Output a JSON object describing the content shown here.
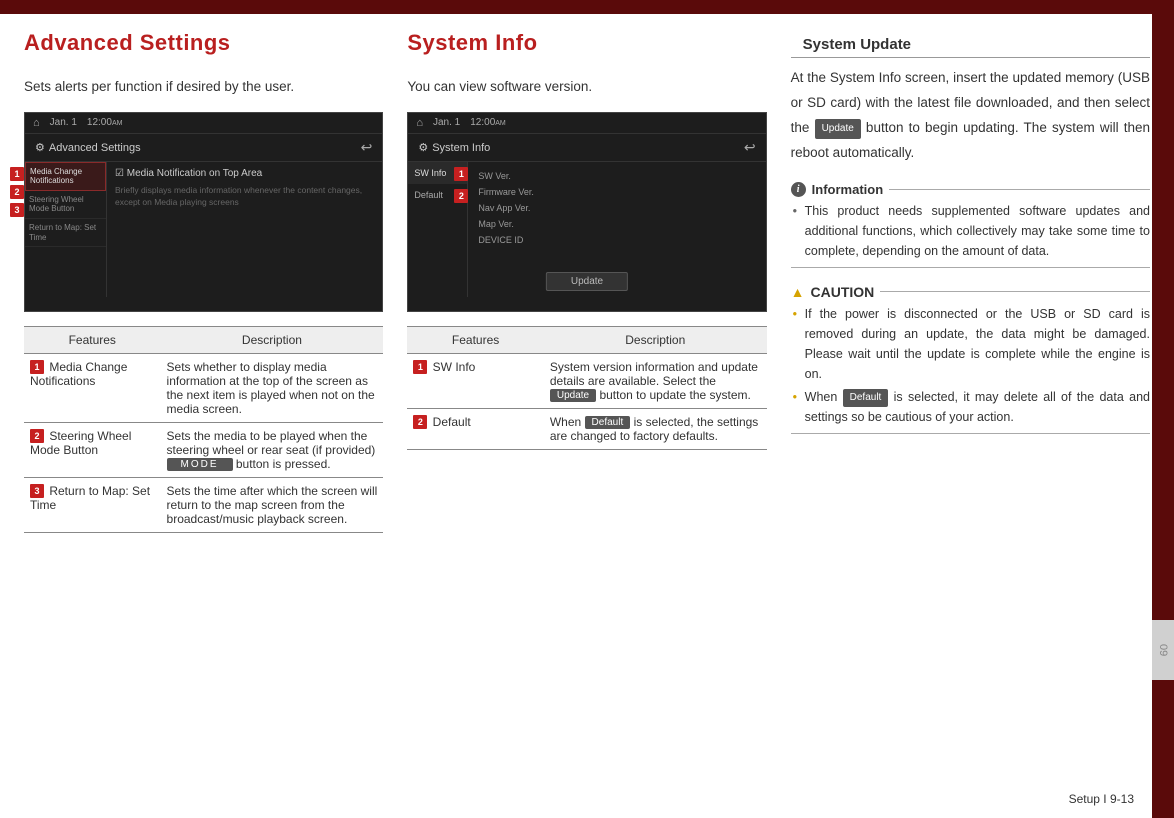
{
  "col1": {
    "heading": "Advanced Settings",
    "intro": "Sets alerts per function if desired by the user.",
    "screenshot": {
      "date": "Jan. 1",
      "time": "12:00",
      "ampm": "AM",
      "title": "Advanced Settings",
      "side_items": [
        "Media Change Notifications",
        "Steering Wheel Mode Button",
        "Return to Map: Set Time"
      ],
      "row1": "Media Notification on Top Area",
      "desc": "Briefly displays media information whenever the content changes, except on Media playing screens"
    },
    "table": {
      "head_features": "Features",
      "head_description": "Description",
      "rows": [
        {
          "num": "1",
          "feature": "Media Change Notifications",
          "desc": "Sets whether to display media information at the top of the screen as the next item is played when not on the media screen."
        },
        {
          "num": "2",
          "feature": "Steering Wheel Mode Button",
          "desc_pre": "Sets the media to be played when the steering wheel or rear seat (if provided) ",
          "chip": "MODE",
          "desc_post": " button is pressed."
        },
        {
          "num": "3",
          "feature": "Return to Map: Set Time",
          "desc": "Sets the time after which the screen will return to the map screen from the broadcast/music playback screen."
        }
      ]
    }
  },
  "col2": {
    "heading": "System Info",
    "intro": "You can view software version.",
    "screenshot": {
      "date": "Jan. 1",
      "time": "12:00",
      "ampm": "AM",
      "title": "System Info",
      "tabs": [
        "SW Info",
        "Default"
      ],
      "lines": [
        "SW Ver.",
        "Firmware Ver.",
        "Nav App Ver.",
        "Map Ver.",
        "DEVICE ID"
      ],
      "update": "Update"
    },
    "table": {
      "head_features": "Features",
      "head_description": "Description",
      "rows": [
        {
          "num": "1",
          "feature": "SW Info",
          "desc_pre": "System version information and update details are available. Select the ",
          "chip": "Update",
          "desc_post": " button to update the system."
        },
        {
          "num": "2",
          "feature": "Default",
          "desc_pre": "When ",
          "chip": "Default",
          "desc_post": " is selected, the settings are changed to factory defaults."
        }
      ]
    }
  },
  "col3": {
    "heading": "System Update",
    "para_pre": "At the System Info screen, insert the updated memory (USB or SD card) with the latest file downloaded, and then select the ",
    "para_chip": "Update",
    "para_post": " button to begin updating. The system will then reboot automatically.",
    "info_label": "Information",
    "info_bullets": [
      "This product needs supplemented software updates and additional functions, which collectively may take some time to complete, depending on the amount of data."
    ],
    "caution_label": "CAUTION",
    "caution_bullets": [
      {
        "text": "If the power is disconnected or the USB or SD card is removed during an update, the data might be damaged. Please wait until the update is complete while the engine is on."
      },
      {
        "pre": "When ",
        "chip": "Default",
        "post": " is selected, it may delete all of the data and settings so be cautious of your action."
      }
    ]
  },
  "side_tab": "09",
  "footer": "Setup I 9-13"
}
